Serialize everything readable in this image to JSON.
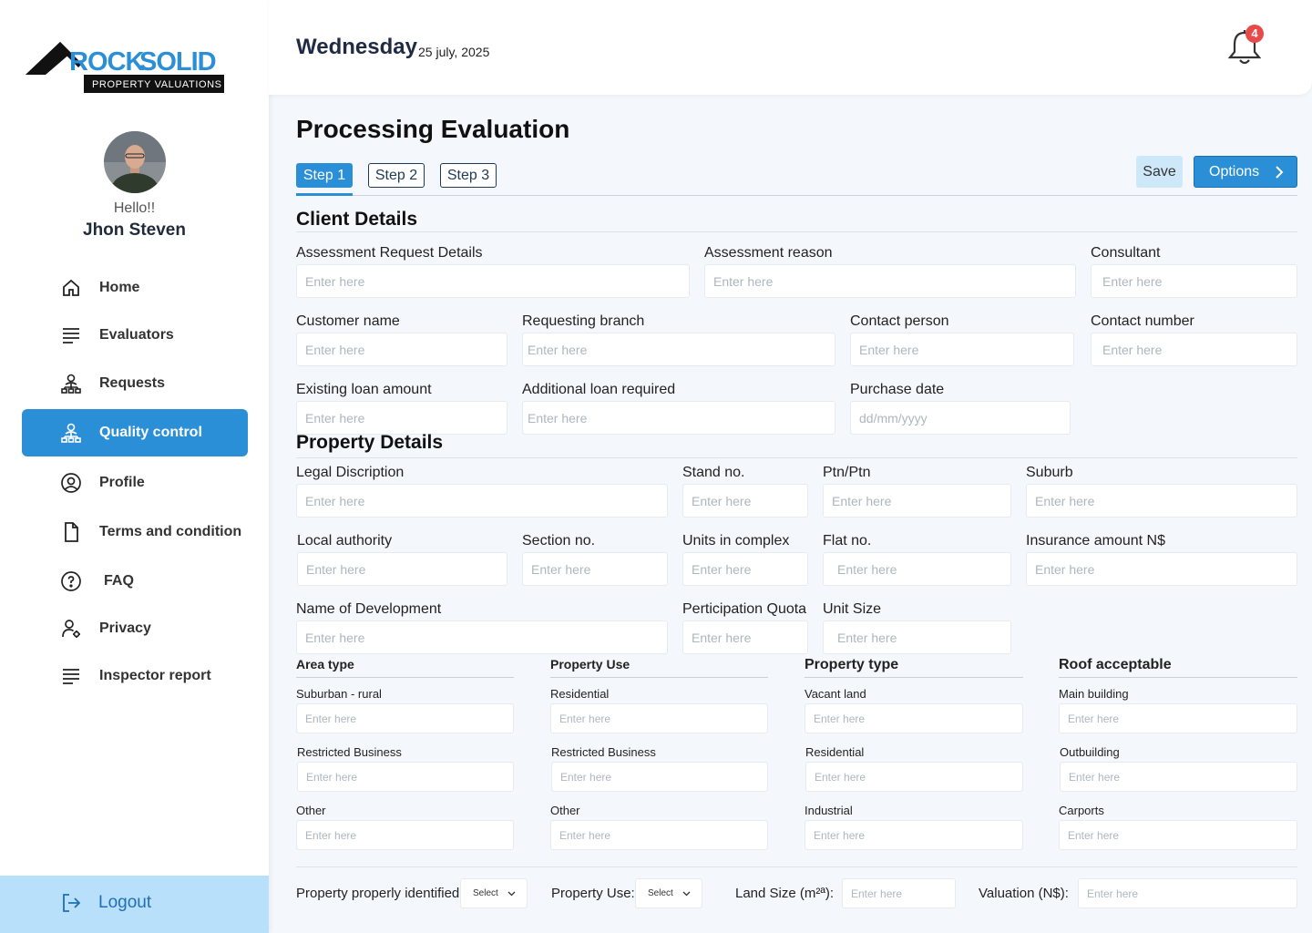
{
  "brand": {
    "name_part1": "ROCK",
    "name_part2": "SOLID",
    "tagline": "PROPERTY VALUATIONS"
  },
  "user": {
    "greeting": "Hello!!",
    "name": "Jhon Steven"
  },
  "nav": [
    {
      "label": "Home",
      "icon": "home-icon"
    },
    {
      "label": "Evaluators",
      "icon": "list-icon"
    },
    {
      "label": "Requests",
      "icon": "org-chart-icon"
    },
    {
      "label": "Quality control",
      "icon": "org-chart-icon",
      "active": true
    },
    {
      "label": "Profile",
      "icon": "user-circle-icon"
    },
    {
      "label": "Terms and condition",
      "icon": "document-icon"
    },
    {
      "label": "FAQ",
      "icon": "question-circle-icon"
    },
    {
      "label": "Privacy",
      "icon": "user-settings-icon"
    },
    {
      "label": "Inspector report",
      "icon": "list-icon"
    }
  ],
  "logout_label": "Logout",
  "header": {
    "day": "Wednesday",
    "date": "25 july, 2025",
    "notification_count": "4"
  },
  "page_title": "Processing Evaluation",
  "steps": [
    "Step 1",
    "Step 2",
    "Step 3"
  ],
  "actions": {
    "save": "Save",
    "options": "Options"
  },
  "client": {
    "title": "Client Details",
    "labels": {
      "assessment_request": "Assessment Request Details",
      "assessment_reason": "Assessment reason",
      "consultant": "Consultant",
      "customer_name": "Customer name",
      "requesting_branch": "Requesting branch",
      "contact_person": "Contact person",
      "contact_number": "Contact number",
      "existing_loan": "Existing loan amount",
      "additional_loan": "Additional loan required",
      "purchase_date": "Purchase date"
    }
  },
  "placeholder": "Enter here",
  "date_placeholder": "dd/mm/yyyy",
  "property": {
    "title": "Property Details",
    "labels": {
      "legal": "Legal Discription",
      "stand": "Stand no.",
      "ptn": "Ptn/Ptn",
      "suburb": "Suburb",
      "local_authority": "Local authority",
      "section": "Section no.",
      "units": "Units in complex",
      "flat": "Flat no.",
      "insurance": "Insurance amount N$",
      "development": "Name of Development",
      "quota": "Perticipation Quota",
      "unit_size": "Unit Size"
    }
  },
  "groups": {
    "area_type": {
      "title": "Area type",
      "items": [
        "Suburban - rural",
        "Restricted Business",
        "Other"
      ]
    },
    "property_use": {
      "title": "Property Use",
      "items": [
        "Residential",
        "Restricted Business",
        "Other"
      ]
    },
    "property_type": {
      "title": "Property type",
      "items": [
        "Vacant land",
        "Residential",
        "Industrial"
      ]
    },
    "roof": {
      "title": "Roof acceptable",
      "items": [
        "Main building",
        "Outbuilding",
        "Carports"
      ]
    }
  },
  "bottom": {
    "identified_label": "Property properly identified:",
    "use_label": "Property Use:",
    "select": "Select",
    "land_size_label": "Land Size (m²ª):",
    "valuation_label": "Valuation (N$):"
  },
  "colors": {
    "accent": "#2b8fd8",
    "logout_bg": "#b9e0fb",
    "badge": "#e84a4a"
  }
}
